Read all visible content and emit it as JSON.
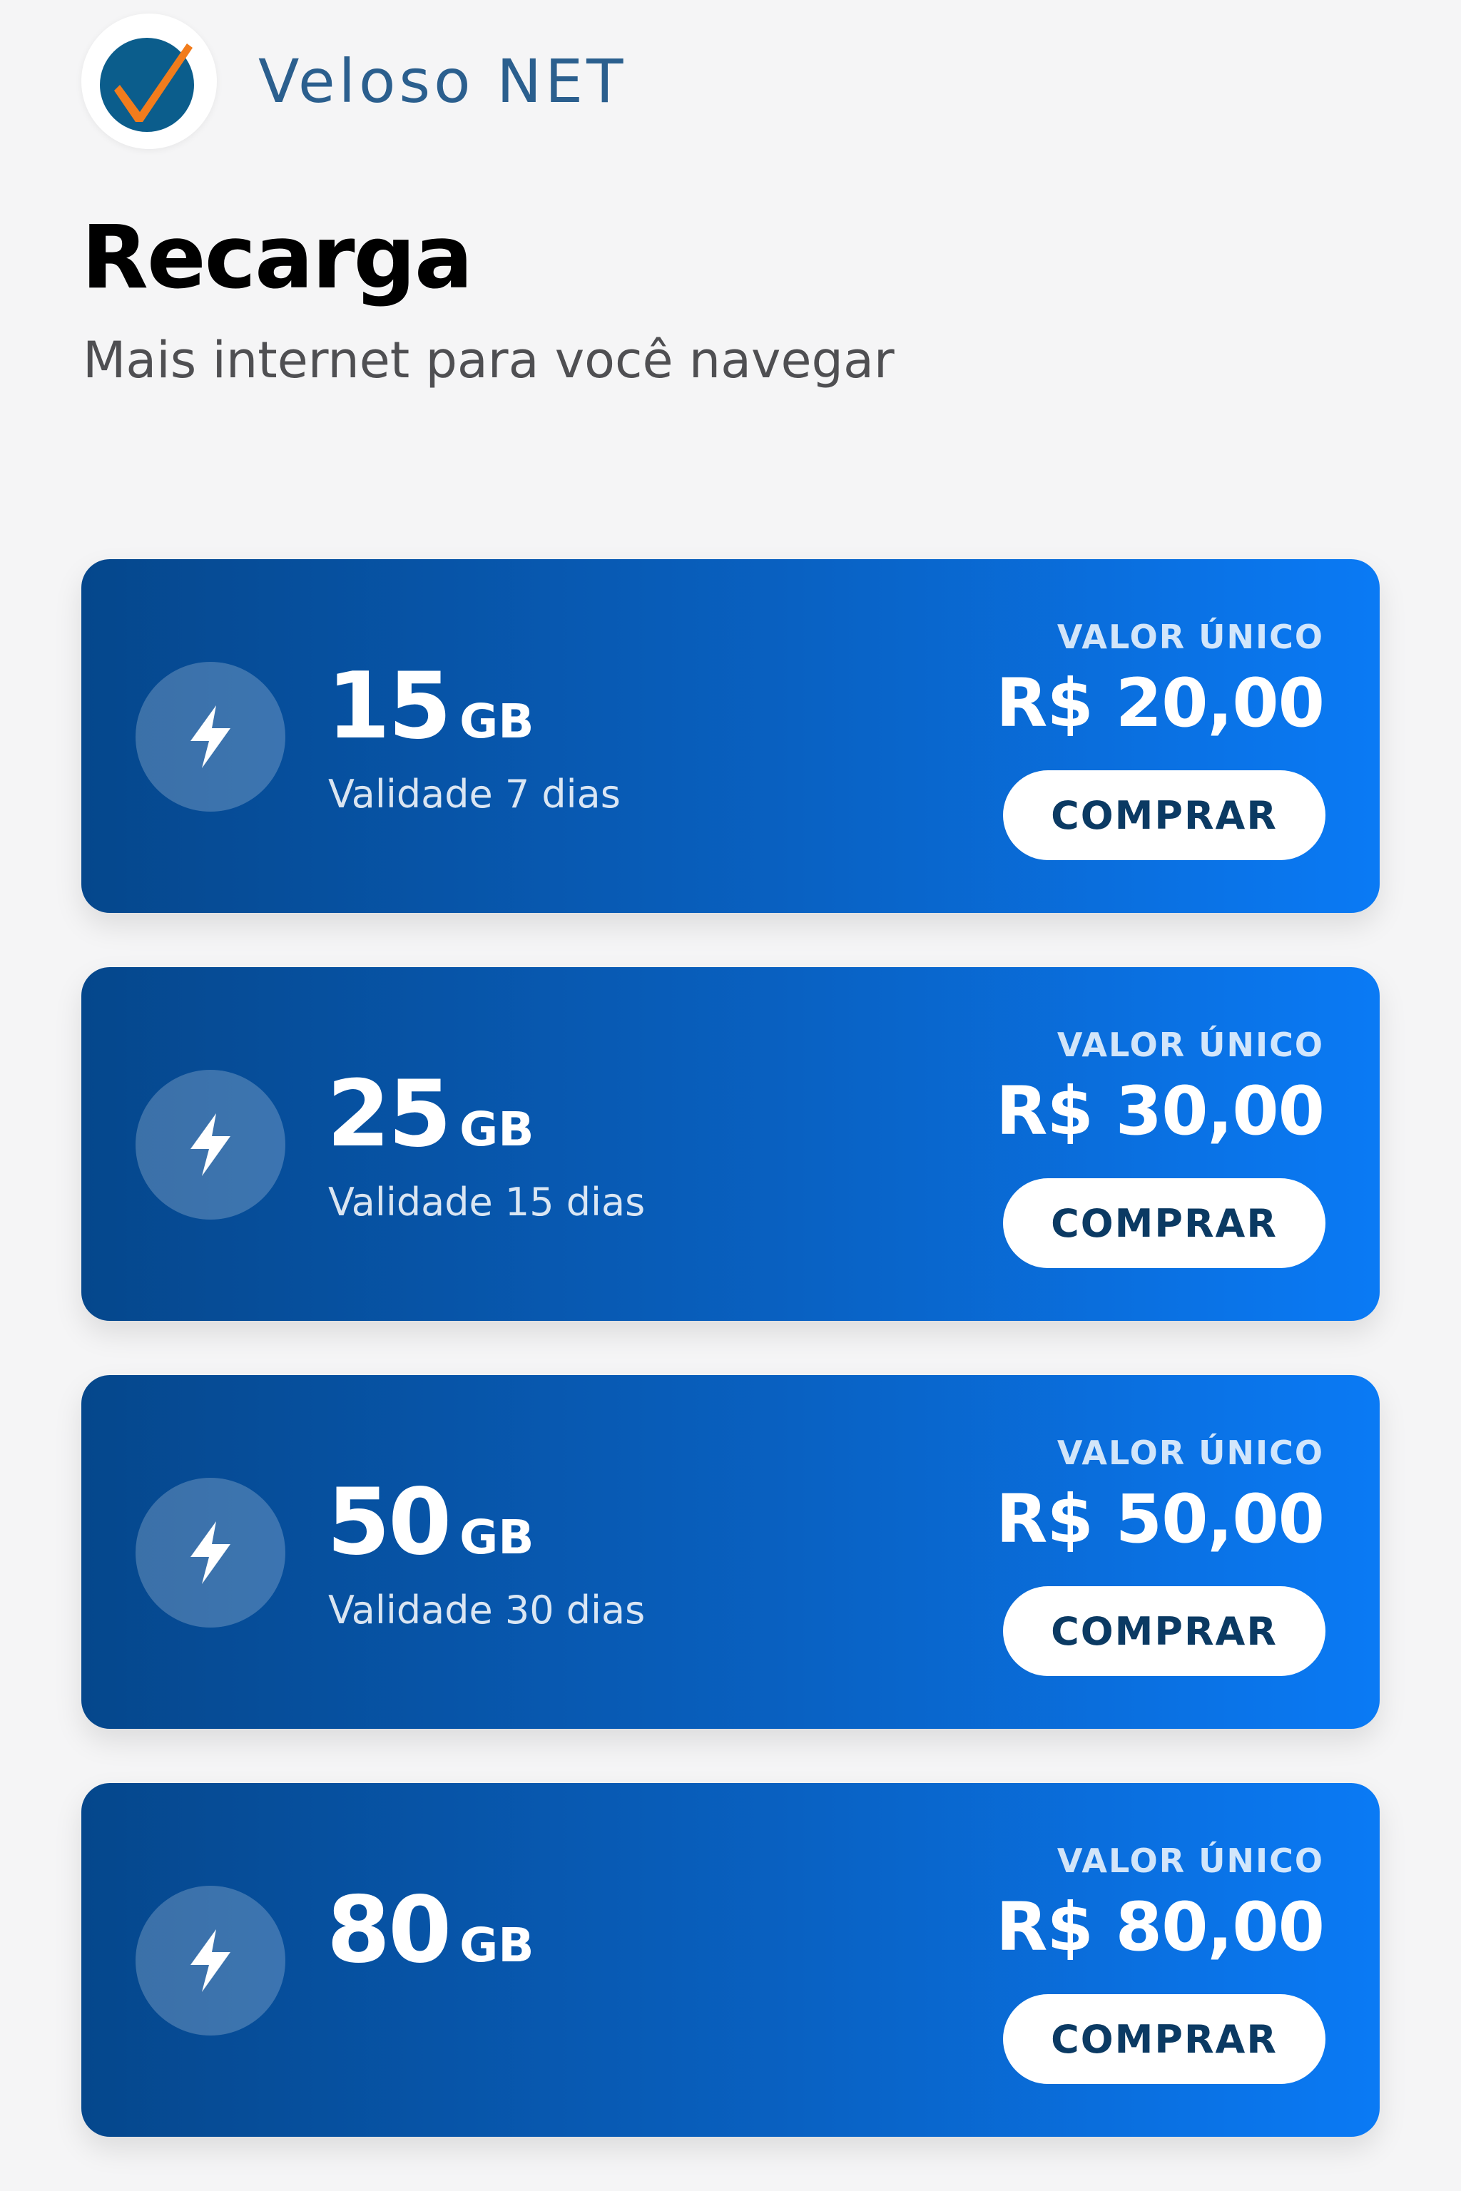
{
  "app": {
    "brand_name": "Veloso NET",
    "logo_icon": "checkmark-logo-icon",
    "colors": {
      "background": "#f5f5f6",
      "brand_text": "#2b5f8e",
      "logo_circle": "#0b5d8c",
      "logo_check": "#f27c1c",
      "card_gradient_start": "#05478c",
      "card_gradient_end": "#0a7af5",
      "button_text": "#0b3a63"
    }
  },
  "page": {
    "title": "Recarga",
    "subtitle": "Mais internet para você navegar"
  },
  "plans": [
    {
      "size": "15",
      "unit": "GB",
      "validity": "Validade 7 dias",
      "price_label": "VALOR ÚNICO",
      "price": "R$ 20,00",
      "button_label": "COMPRAR",
      "icon": "lightning-bolt-icon"
    },
    {
      "size": "25",
      "unit": "GB",
      "validity": "Validade 15 dias",
      "price_label": "VALOR ÚNICO",
      "price": "R$ 30,00",
      "button_label": "COMPRAR",
      "icon": "lightning-bolt-icon"
    },
    {
      "size": "50",
      "unit": "GB",
      "validity": "Validade 30 dias",
      "price_label": "VALOR ÚNICO",
      "price": "R$ 50,00",
      "button_label": "COMPRAR",
      "icon": "lightning-bolt-icon"
    },
    {
      "size": "80",
      "unit": "GB",
      "validity": "",
      "price_label": "VALOR ÚNICO",
      "price": "R$ 80,00",
      "button_label": "COMPRAR",
      "icon": "lightning-bolt-icon"
    }
  ]
}
